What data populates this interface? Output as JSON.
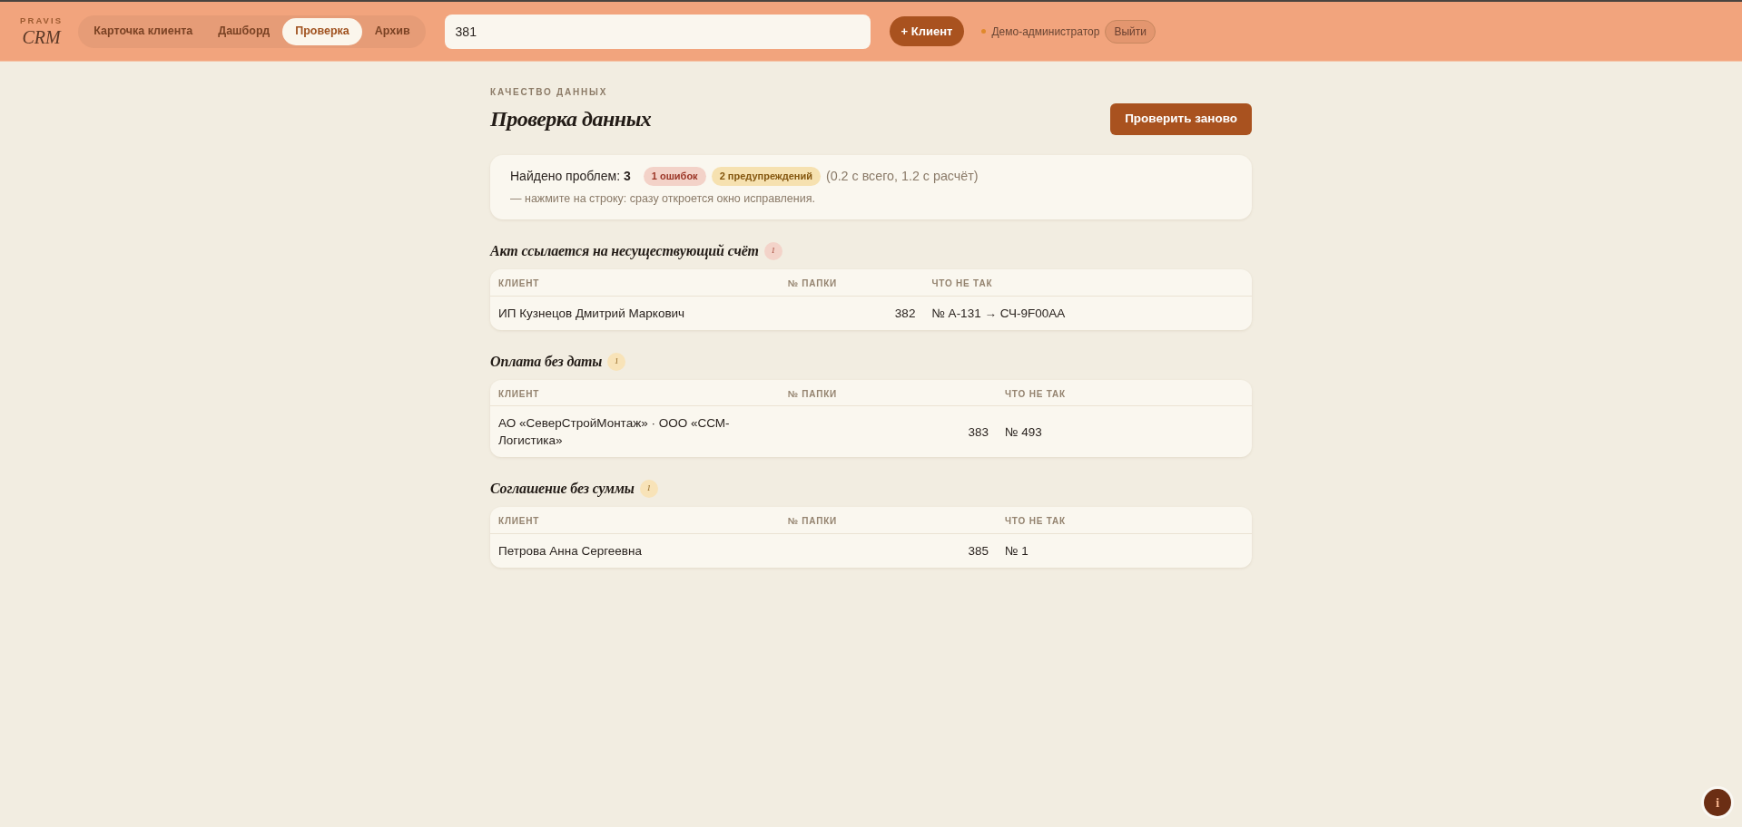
{
  "header": {
    "logo": {
      "top": "PRAVIS",
      "bottom": "CRM"
    },
    "tabs": [
      {
        "label": "Карточка клиента",
        "selected": false
      },
      {
        "label": "Дашборд",
        "selected": false
      },
      {
        "label": "Проверка",
        "selected": true
      },
      {
        "label": "Архив",
        "selected": false
      }
    ],
    "search": {
      "value": "381"
    },
    "add_button": "+ Клиент",
    "user": "Демо-администратор",
    "logout_button": "Выйти"
  },
  "page": {
    "eyebrow": "КАЧЕСТВО ДАННЫХ",
    "title": "Проверка данных",
    "recheck_button": "Проверить заново"
  },
  "summary": {
    "found": "Найдено проблем: **3**",
    "badges": [
      {
        "kind": "error",
        "text": "1 ошибок"
      },
      {
        "kind": "warning",
        "text": "2 предупреждений"
      }
    ],
    "timing": "(0.2 с всего, 1.2 с расчёт)",
    "hint": "— нажмите на строку: сразу откроется окно исправления."
  },
  "sections": [
    {
      "title": "Акт ссылается на несуществующий счёт",
      "kind": "error",
      "count": "1",
      "columns": [
        "КЛИЕНТ",
        "№ ПАПКИ",
        "ЧТО НЕ ТАК"
      ],
      "rows": [
        {
          "client": "ИП Кузнецов Дмитрий Маркович",
          "folder": "382",
          "issue": "№ А-131 → СЧ-9F00AA"
        }
      ]
    },
    {
      "title": "Оплата без даты",
      "kind": "warning",
      "count": "1",
      "columns": [
        "КЛИЕНТ",
        "№ ПАПКИ",
        "ЧТО НЕ ТАК"
      ],
      "rows": [
        {
          "client": "АО «СеверСтройМонтаж» · ООО «ССМ-Логистика»",
          "folder": "383",
          "issue": "№ 493"
        }
      ]
    },
    {
      "title": "Соглашение без суммы",
      "kind": "warning",
      "count": "1",
      "columns": [
        "КЛИЕНТ",
        "№ ПАПКИ",
        "ЧТО НЕ ТАК"
      ],
      "rows": [
        {
          "client": "Петрова Анна Сергеевна",
          "folder": "385",
          "issue": "№ 1"
        }
      ]
    }
  ],
  "info_button": "i"
}
